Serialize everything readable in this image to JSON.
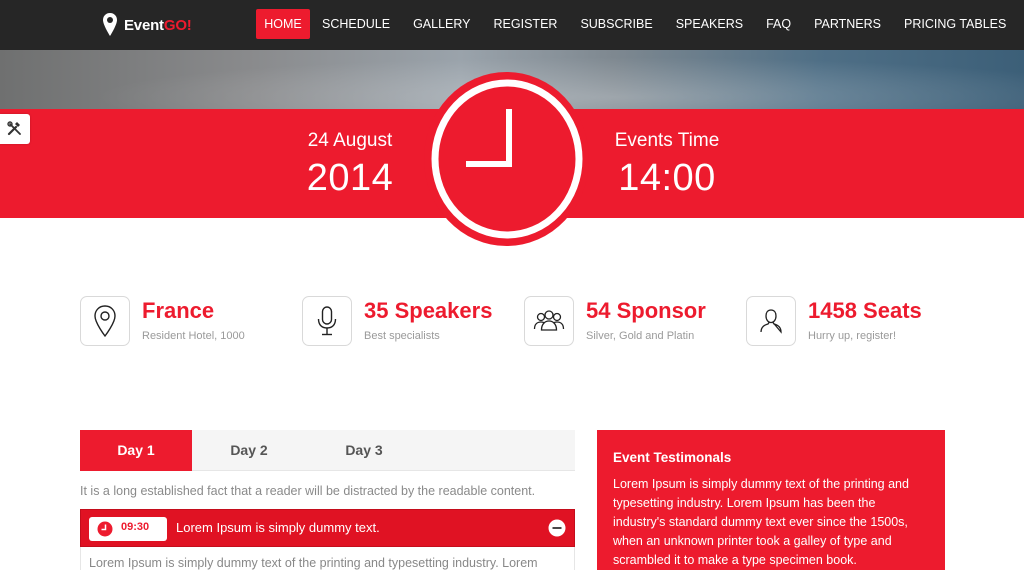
{
  "brand": {
    "name_prefix": "Event",
    "name_accent": "GO!",
    "accent_color": "#ed1b2e"
  },
  "nav": {
    "items": [
      {
        "label": "HOME",
        "active": true
      },
      {
        "label": "SCHEDULE"
      },
      {
        "label": "GALLERY"
      },
      {
        "label": "REGISTER"
      },
      {
        "label": "SUBSCRIBE"
      },
      {
        "label": "SPEAKERS"
      },
      {
        "label": "FAQ"
      },
      {
        "label": "PARTNERS"
      },
      {
        "label": "PRICING TABLES"
      }
    ]
  },
  "hero": {
    "date_small": "24 August",
    "date_big": "2014",
    "time_small": "Events Time",
    "time_big": "14:00",
    "clock_icon": "clock-icon",
    "tool_icon": "tools-icon"
  },
  "features": [
    {
      "icon": "map-pin-icon",
      "title": "France",
      "subtitle": "Resident Hotel, 1000"
    },
    {
      "icon": "microphone-icon",
      "title": "35 Speakers",
      "subtitle": "Best specialists"
    },
    {
      "icon": "group-icon",
      "title": "54 Sponsor",
      "subtitle": "Silver, Gold and Platin"
    },
    {
      "icon": "user-icon",
      "title": "1458 Seats",
      "subtitle": "Hurry up, register!"
    }
  ],
  "schedule": {
    "tabs": [
      {
        "label": "Day 1",
        "active": true
      },
      {
        "label": "Day 2"
      },
      {
        "label": "Day 3"
      }
    ],
    "intro": "It is a long established fact that a reader will be distracted by the readable content.",
    "session": {
      "time": "09:30",
      "title": "Lorem Ipsum is simply dummy text.",
      "body": "Lorem Ipsum is simply dummy text of the printing and typesetting industry. Lorem"
    }
  },
  "testimonials": {
    "title": "Event Testimonals",
    "text": "Lorem Ipsum is simply dummy text of the printing and typesetting industry. Lorem Ipsum has been the industry's standard dummy text ever since the 1500s, when an unknown printer took a galley of type and scrambled it to make a type specimen book."
  }
}
